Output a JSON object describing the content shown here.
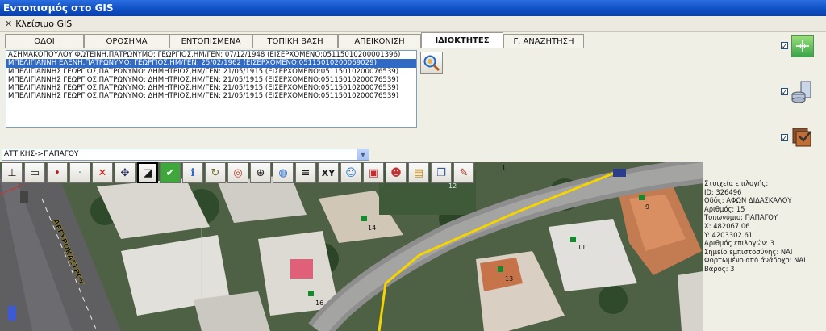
{
  "window": {
    "title": "Εντοπισμός στο GIS"
  },
  "closebar": {
    "label": "Κλείσιμο GIS"
  },
  "tabs": [
    {
      "label": "ΟΔΟΙ",
      "w": 98
    },
    {
      "label": "ΟΡΟΣΗΜΑ",
      "w": 106
    },
    {
      "label": "ΕΝΤΟΠΙΣΜΕΝΑ",
      "w": 103
    },
    {
      "label": "ΤΟΠΙΚΗ ΒΑΣΗ",
      "w": 106
    },
    {
      "label": "ΑΠΕΙΚΟΝΙΣΗ",
      "w": 103
    },
    {
      "label": "ΙΔΙΟΚΤΗΤΕΣ",
      "w": 102
    },
    {
      "label": "Γ. ΑΝΑΖΗΤΗΣΗ",
      "w": 100
    }
  ],
  "owners": [
    "ΑΣΗΜΑΚΟΠΟΥΛΟΥ ΦΩΤΕΙΝΗ,ΠΑΤΡΩΝΥΜΟ: ΓΕΩΡΓΙΟΣ,ΗΜ/ΓΕΝ: 07/12/1948 (ΕΙΣΕΡΧΟΜΕΝΟ:05115010200001396)",
    "ΜΠΕΛΙΓΙΑΝΝΗ ΕΛΕΝΗ,ΠΑΤΡΩΝΥΜΟ: ΓΕΩΡΓΙΟΣ,ΗΜ/ΓΕΝ: 25/02/1962 (ΕΙΣΕΡΧΟΜΕΝΟ:05115010200069029)",
    "ΜΠΕΛΙΓΙΑΝΝΗΣ ΓΕΩΡΓΙΟΣ,ΠΑΤΡΩΝΥΜΟ: ΔΗΜΗΤΡΙΟΣ,ΗΜ/ΓΕΝ: 21/05/1915 (ΕΙΣΕΡΧΟΜΕΝΟ:05115010200076539)",
    "ΜΠΕΛΙΓΙΑΝΝΗΣ ΓΕΩΡΓΙΟΣ,ΠΑΤΡΩΝΥΜΟ: ΔΗΜΗΤΡΙΟΣ,ΗΜ/ΓΕΝ: 21/05/1915 (ΕΙΣΕΡΧΟΜΕΝΟ:05115010200076539)",
    "ΜΠΕΛΙΓΙΑΝΝΗΣ ΓΕΩΡΓΙΟΣ,ΠΑΤΡΩΝΥΜΟ: ΔΗΜΗΤΡΙΟΣ,ΗΜ/ΓΕΝ: 21/05/1915 (ΕΙΣΕΡΧΟΜΕΝΟ:05115010200076539)",
    "ΜΠΕΛΙΓΙΑΝΝΗΣ ΓΕΩΡΓΙΟΣ,ΠΑΤΡΩΝΥΜΟ: ΔΗΜΗΤΡΙΟΣ,ΗΜ/ΓΕΝ: 21/05/1915 (ΕΙΣΕΡΧΟΜΕΝΟ:05115010200076539)"
  ],
  "location_select": {
    "value": "ΑΤΤΙΚΗΣ->ΠΑΠΑΓΟΥ"
  },
  "side_checks": [
    "✓",
    "✓",
    "✓"
  ],
  "tools": [
    {
      "name": "compass-tool",
      "glyph": "⊥"
    },
    {
      "name": "open-folder-tool",
      "glyph": "▭"
    },
    {
      "name": "add-vertex-tool",
      "glyph": "•"
    },
    {
      "name": "point-tool",
      "glyph": "·"
    },
    {
      "name": "delete-tool",
      "glyph": "✕"
    },
    {
      "name": "pan-tool",
      "glyph": "✥"
    },
    {
      "name": "select-area-tool",
      "glyph": "◪"
    },
    {
      "name": "confirm-tool",
      "glyph": "✔"
    },
    {
      "name": "info-tool",
      "glyph": "ℹ"
    },
    {
      "name": "refresh-tool",
      "glyph": "↻"
    },
    {
      "name": "target-tool",
      "glyph": "◎"
    },
    {
      "name": "zoom-tool",
      "glyph": "⊕"
    },
    {
      "name": "globe-tool",
      "glyph": "◍"
    },
    {
      "name": "layers-tool",
      "glyph": "≡"
    },
    {
      "name": "xy-tool",
      "glyph": "XY"
    },
    {
      "name": "user-locate-tool",
      "glyph": "☺"
    },
    {
      "name": "map-users-tool",
      "glyph": "▣"
    },
    {
      "name": "group-tool",
      "glyph": "☻"
    },
    {
      "name": "paste-tool",
      "glyph": "▤"
    },
    {
      "name": "copy-tool",
      "glyph": "❐"
    },
    {
      "name": "pen-tool",
      "glyph": "✎"
    }
  ],
  "map": {
    "street_name": "ΑΡΓΥΡΟΚΑΣΤΡΟΥ",
    "labels": [
      "12",
      "9",
      "14",
      "11",
      "13",
      "16",
      "1"
    ]
  },
  "info": {
    "lines": [
      "Στοιχεία επιλογής:",
      "ID: 326496",
      "Οδός: ΑΦΩΝ ΔΙΔΑΣΚΑΛΟΥ",
      "Αριθμός: 15",
      "Τοπωνύμιο: ΠΑΠΑΓΟΥ",
      "X: 482067.06",
      "Y: 4203302.61",
      "Αριθμός επιλογών: 3",
      "Σημείο εμπιστοσύνης: ΝΑΙ",
      "Φορτωμένο από άνάδοχο: ΝΑΙ",
      "Βάρος: 3"
    ]
  },
  "colors": {
    "title": "#0e4fc4",
    "selection": "#316ac5",
    "route": "#f5d400",
    "parcel_marker": "#138a2b"
  }
}
